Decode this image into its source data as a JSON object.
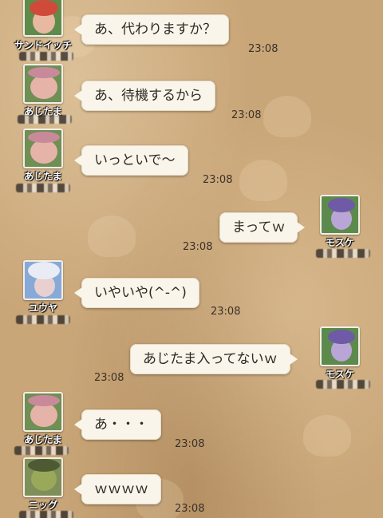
{
  "messages": [
    {
      "side": "left",
      "sender": "サンドイッチ",
      "text": "あ、代わりますか？",
      "time": "23:08",
      "avatar_bg": "#5f8b4a",
      "face": "#e8b8a0",
      "hair": "#d04a3a"
    },
    {
      "side": "left",
      "sender": "あじたま",
      "text": "あ、待機するから",
      "time": "23:08",
      "avatar_bg": "#6f8f55",
      "face": "#e6b3a8",
      "hair": "#c88a9a"
    },
    {
      "side": "left",
      "sender": "あじたま",
      "text": "いっといで～",
      "time": "23:08",
      "avatar_bg": "#6f8f55",
      "face": "#e6b3a8",
      "hair": "#c88a9a"
    },
    {
      "side": "right",
      "sender": "モスケ",
      "text": "まってｗ",
      "time": "23:08",
      "avatar_bg": "#5c8a4c",
      "face": "#b9a6d6",
      "hair": "#6e5aa6"
    },
    {
      "side": "left",
      "sender": "ユウヤ",
      "text": "いやいや(^-^)",
      "time": "23:08",
      "avatar_bg": "#86a9d8",
      "face": "#e8d0d0",
      "hair": "#e9ecf4"
    },
    {
      "side": "right",
      "sender": "モスケ",
      "text": "あじたま入ってないｗ",
      "time": "23:08",
      "avatar_bg": "#5c8a4c",
      "face": "#b9a6d6",
      "hair": "#6e5aa6"
    },
    {
      "side": "left",
      "sender": "あじたま",
      "text": "あ・・・",
      "time": "23:08",
      "avatar_bg": "#6f8f55",
      "face": "#e6b3a8",
      "hair": "#c88a9a"
    },
    {
      "side": "left",
      "sender": "ニッグ",
      "text": "ｗｗｗｗ",
      "time": "23:08",
      "avatar_bg": "#7e8f5a",
      "face": "#9aa85a",
      "hair": "#4e5a32"
    }
  ],
  "colors": {
    "background": "#c9a678",
    "bubble": "#faf5ea",
    "text": "#2d2a26"
  }
}
